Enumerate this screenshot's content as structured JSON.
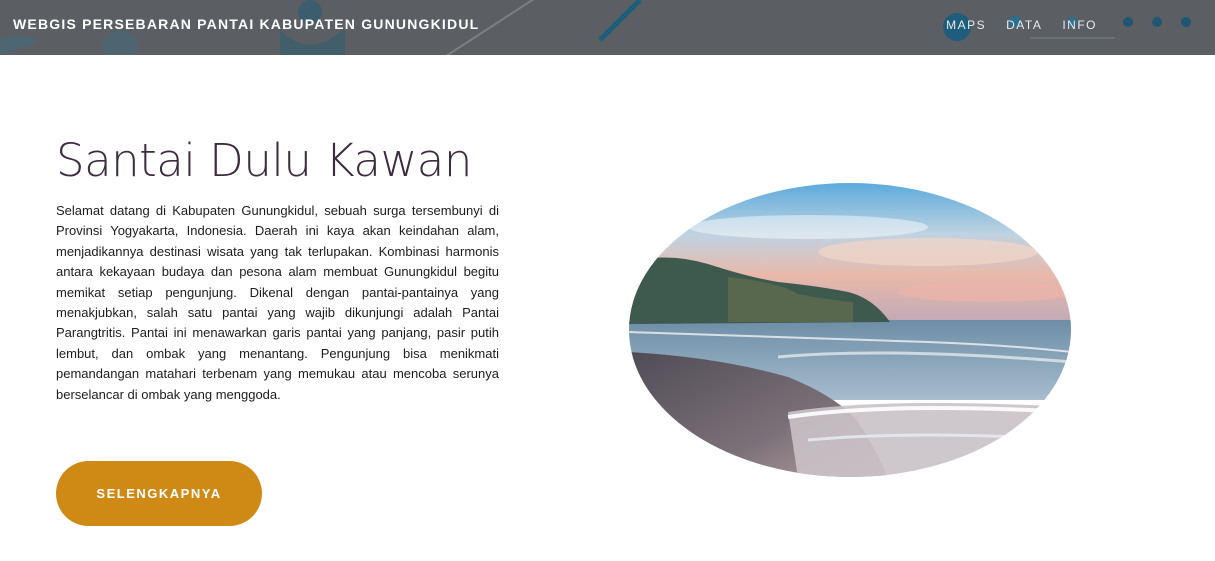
{
  "navbar": {
    "brand": "WEBGIS PERSEBARAN PANTAI KABUPATEN GUNUNGKIDUL",
    "menu": [
      {
        "label": "MAPS"
      },
      {
        "label": "DATA"
      },
      {
        "label": "INFO"
      }
    ]
  },
  "hero": {
    "title": "Santai Dulu Kawan",
    "description": "Selamat datang di Kabupaten Gunungkidul, sebuah surga tersembunyi di Provinsi Yogyakarta, Indonesia. Daerah ini kaya akan keindahan alam, menjadikannya destinasi wisata yang tak terlupakan. Kombinasi harmonis antara kekayaan budaya dan pesona alam membuat Gunungkidul begitu memikat setiap pengunjung. Dikenal dengan pantai-pantainya yang menakjubkan, salah satu pantai yang wajib dikunjungi adalah Pantai Parangtritis. Pantai ini menawarkan garis pantai yang panjang, pasir putih lembut, dan ombak yang menantang. Pengunjung bisa menikmati pemandangan matahari terbenam yang memukau atau mencoba serunya berselancar di ombak yang menggoda.",
    "button_label": "SELENGKAPNYA"
  },
  "colors": {
    "navbar_bg": "#5b5f63",
    "accent": "#cf8a16",
    "title": "#3d2b3f"
  }
}
